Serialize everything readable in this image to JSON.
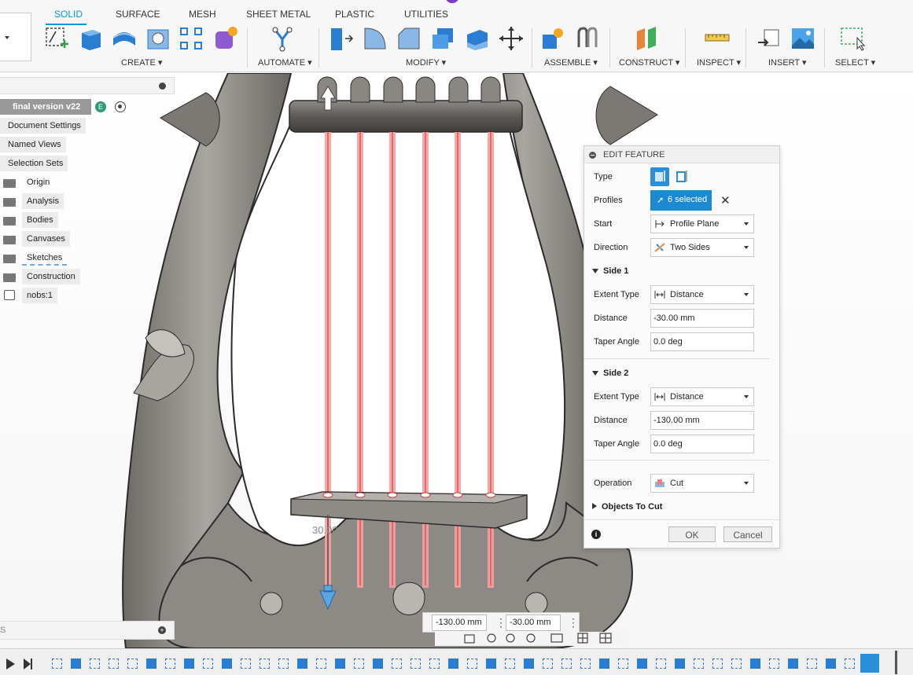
{
  "toolbar": {
    "tabs": [
      "SOLID",
      "SURFACE",
      "MESH",
      "SHEET METAL",
      "PLASTIC",
      "UTILITIES"
    ],
    "groups": [
      "CREATE",
      "AUTOMATE",
      "MODIFY",
      "ASSEMBLE",
      "CONSTRUCT",
      "INSPECT",
      "INSERT",
      "SELECT"
    ],
    "accent": "#0696d7"
  },
  "browser": {
    "root": "final version v22",
    "items": [
      "Document Settings",
      "Named Views",
      "Selection Sets",
      "Origin",
      "Analysis",
      "Bodies",
      "Canvases",
      "Sketches",
      "Construction",
      "nobs:1"
    ]
  },
  "edit_feature": {
    "title": "EDIT FEATURE",
    "type_label": "Type",
    "profiles_label": "Profiles",
    "profiles_value": "6 selected",
    "start_label": "Start",
    "start_value": "Profile Plane",
    "direction_label": "Direction",
    "direction_value": "Two Sides",
    "side1": {
      "title": "Side 1",
      "extent_label": "Extent Type",
      "extent_value": "Distance",
      "distance_label": "Distance",
      "distance_value": "-30.00 mm",
      "taper_label": "Taper Angle",
      "taper_value": "0.0 deg"
    },
    "side2": {
      "title": "Side 2",
      "extent_label": "Extent Type",
      "extent_value": "Distance",
      "distance_label": "Distance",
      "distance_value": "-130.00 mm",
      "taper_label": "Taper Angle",
      "taper_value": "0.0 deg"
    },
    "operation_label": "Operation",
    "operation_value": "Cut",
    "objects_label": "Objects To Cut",
    "ok": "OK",
    "cancel": "Cancel"
  },
  "viewport": {
    "dimension_label": "30.00",
    "input_a": "-130.00 mm",
    "input_b": "-30.00 mm"
  },
  "bottom_panel_label": "S"
}
